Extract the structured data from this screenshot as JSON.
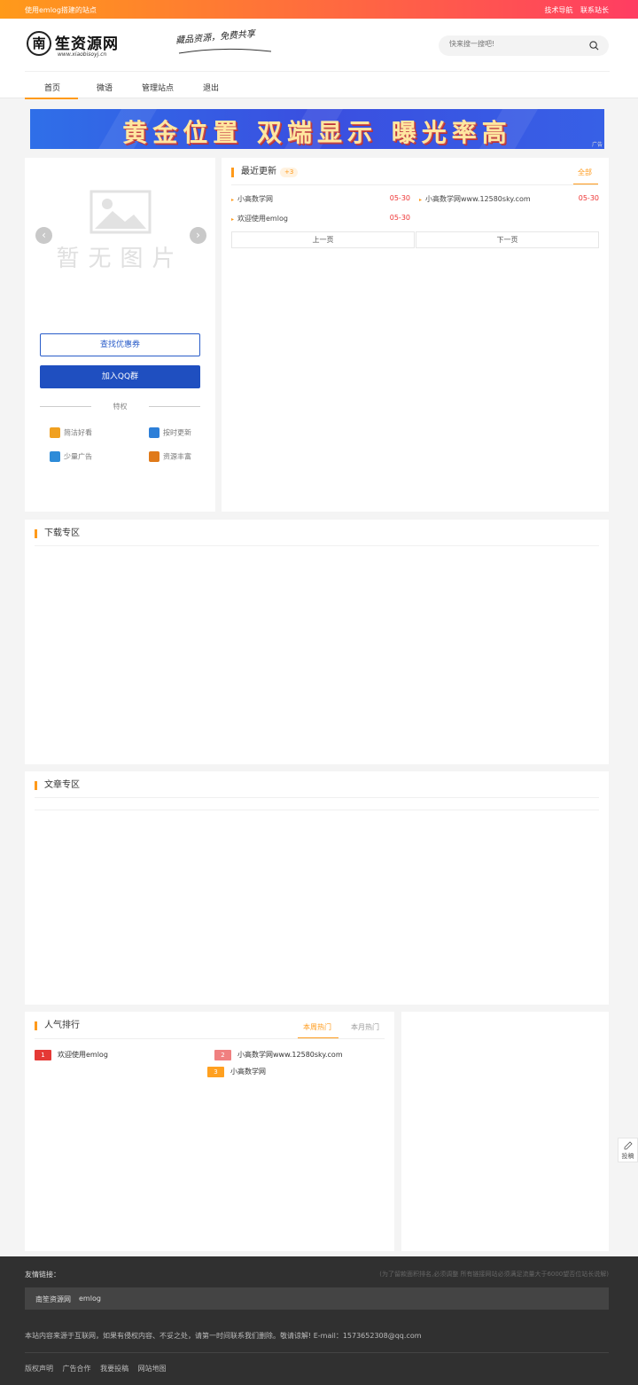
{
  "topbar": {
    "left": "使用emlog搭建的站点",
    "links": [
      "技术导航",
      "联系站长"
    ]
  },
  "logo": {
    "char": "南",
    "name": "笙资源网",
    "sub": "www.xiaobisoyj.cn"
  },
  "slogan": "藏品资源，免费共享",
  "search": {
    "placeholder": "快来搜一搜吧!"
  },
  "nav": {
    "items": [
      "首页",
      "微语",
      "管理站点",
      "退出"
    ]
  },
  "banner": {
    "text": "黄金位置  双端显示  曝光率高",
    "ad_label": "广告"
  },
  "slider": {
    "placeholder_text": "暂无图片"
  },
  "sidebar_card": {
    "coupon_button": "查找优惠券",
    "qq_button": "加入QQ群",
    "privilege_title": "特权",
    "features": [
      {
        "label": "简洁好看",
        "icon": "envelope-icon",
        "color": "#f0a020"
      },
      {
        "label": "按时更新",
        "icon": "document-icon",
        "color": "#2d7fd8"
      },
      {
        "label": "少量广告",
        "icon": "ad-icon",
        "color": "#2d8bd8"
      },
      {
        "label": "资源丰富",
        "icon": "laptop-icon",
        "color": "#e07a1a"
      }
    ]
  },
  "latest": {
    "title": "最近更新",
    "badge": "+3",
    "all_link": "全部",
    "items": [
      {
        "title": "小高数学网",
        "date": "05-30"
      },
      {
        "title": "小高数学网www.12580sky.com",
        "date": "05-30"
      },
      {
        "title": "欢迎使用emlog",
        "date": "05-30"
      }
    ],
    "prev": "上一页",
    "next": "下一页"
  },
  "download": {
    "title": "下载专区"
  },
  "articles": {
    "title": "文章专区"
  },
  "popular": {
    "title": "人气排行",
    "tabs": [
      "本周热门",
      "本月热门"
    ],
    "items": [
      {
        "rank": "1",
        "title": "欢迎使用emlog",
        "color": "#e53935"
      },
      {
        "rank": "2",
        "title": "小高数学网www.12580sky.com",
        "color": "#f08080"
      },
      {
        "rank": "3",
        "title": "小高数学网",
        "color": "#ffa020"
      }
    ]
  },
  "side_button": {
    "label": "投稿"
  },
  "footer": {
    "links_title": "友情链接：",
    "links_note": "(为了留款面积排名,必须调整 所有链接网站必须满足流量大于6000望否位站长说解)",
    "links": [
      "南笙资源网",
      "emlog"
    ],
    "notice": "本站内容来源于互联网，如果有侵权内容、不妥之处，请第一时间联系我们删除。敬请谅解! E-mail：1573652308@qq.com",
    "bottom_links": [
      "版权声明",
      "广告合作",
      "我要投稿",
      "网站地图"
    ]
  }
}
